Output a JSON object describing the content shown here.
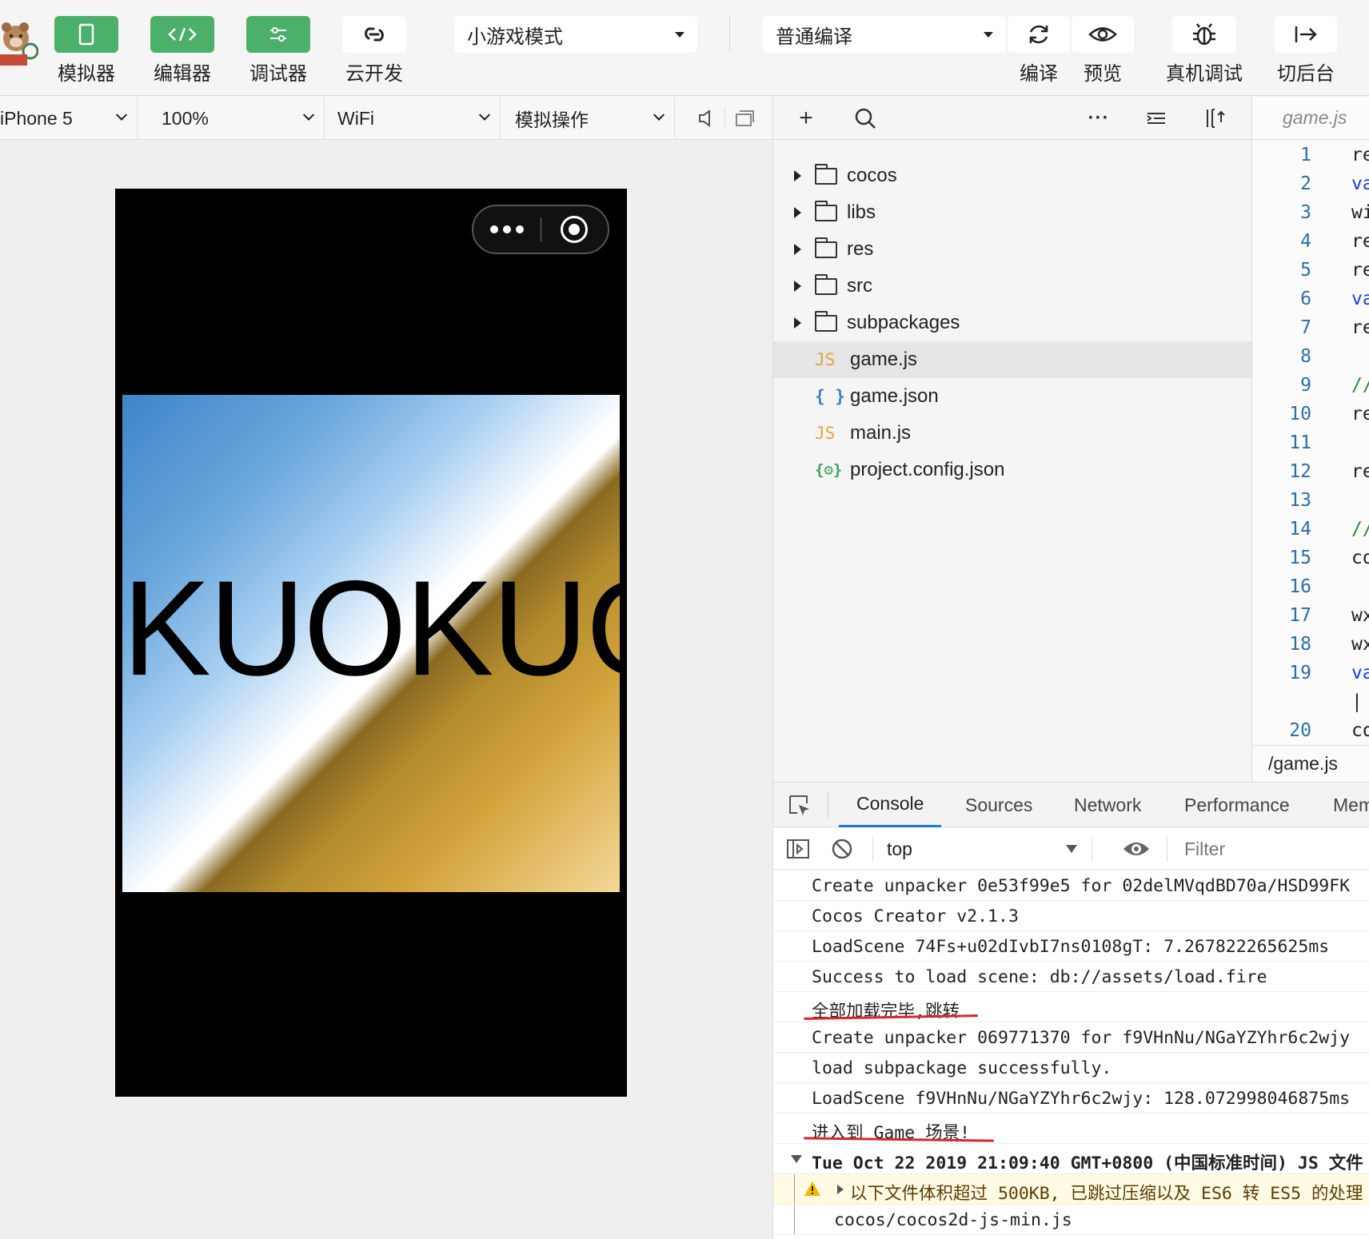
{
  "toolbar": {
    "buttons": [
      {
        "label": "模拟器"
      },
      {
        "label": "编辑器"
      },
      {
        "label": "调试器"
      },
      {
        "label": "云开发"
      }
    ],
    "mode_select": "小游戏模式",
    "compile_select": "普通编译",
    "actions": [
      {
        "label": "编译"
      },
      {
        "label": "预览"
      },
      {
        "label": "真机调试"
      },
      {
        "label": "切后台"
      }
    ]
  },
  "simulator_bar": {
    "device": "iPhone 5",
    "zoom": "100%",
    "network": "WiFi",
    "operation": "模拟操作"
  },
  "game": {
    "title_text": "KUOKUO"
  },
  "explorer": {
    "folders": [
      "cocos",
      "libs",
      "res",
      "src",
      "subpackages"
    ],
    "files": [
      {
        "type": "JS",
        "name": "game.js"
      },
      {
        "type": "{ }",
        "name": "game.json"
      },
      {
        "type": "JS",
        "name": "main.js"
      },
      {
        "type": "{⚙}",
        "name": "project.config.json"
      }
    ],
    "selected": "game.js"
  },
  "editor": {
    "tab": "game.js",
    "lines": [
      {
        "n": "1",
        "code": "re"
      },
      {
        "n": "2",
        "code": "va"
      },
      {
        "n": "3",
        "code": "wi"
      },
      {
        "n": "4",
        "code": "re"
      },
      {
        "n": "5",
        "code": "re"
      },
      {
        "n": "6",
        "code": "va"
      },
      {
        "n": "7",
        "code": "re"
      },
      {
        "n": "8",
        "code": ""
      },
      {
        "n": "9",
        "code": "//"
      },
      {
        "n": "10",
        "code": "re"
      },
      {
        "n": "11",
        "code": ""
      },
      {
        "n": "12",
        "code": "re"
      },
      {
        "n": "13",
        "code": ""
      },
      {
        "n": "14",
        "code": "//"
      },
      {
        "n": "15",
        "code": "co"
      },
      {
        "n": "16",
        "code": ""
      },
      {
        "n": "17",
        "code": "wx"
      },
      {
        "n": "18",
        "code": "wx"
      },
      {
        "n": "19",
        "code": "va"
      },
      {
        "n": "",
        "code": "|"
      },
      {
        "n": "20",
        "code": "co"
      }
    ],
    "footer_path": "/game.js"
  },
  "devtools": {
    "tabs": [
      "Console",
      "Sources",
      "Network",
      "Performance",
      "Memory"
    ],
    "context": "top",
    "filter_placeholder": "Filter",
    "console_lines": [
      "Create unpacker 0e53f99e5 for 02delMVqdBD70a/HSD99FK",
      "Cocos Creator v2.1.3",
      "LoadScene 74Fs+u02dIvbI7ns0108gT: 7.267822265625ms",
      "Success to load scene: db://assets/load.fire",
      "全部加载完毕,跳转",
      "Create unpacker 069771370 for f9VHnNu/NGaYZYhr6c2wjy",
      "load subpackage successfully.",
      "LoadScene f9VHnNu/NGaYZYhr6c2wjy: 128.072998046875ms",
      "进入到 Game 场景!",
      "Tue Oct 22 2019 21:09:40 GMT+0800 (中国标准时间) JS 文件",
      "以下文件体积超过 500KB, 已跳过压缩以及 ES6 转 ES5 的处理",
      "cocos/cocos2d-js-min.js"
    ]
  }
}
